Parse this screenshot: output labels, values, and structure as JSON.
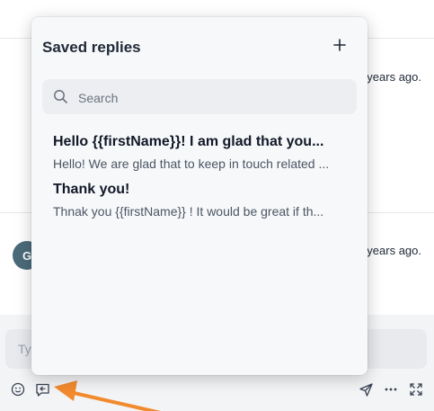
{
  "background": {
    "times": [
      "years ago.",
      "years ago."
    ],
    "avatar_initial": "G",
    "composer_placeholder": "Ty"
  },
  "popover": {
    "title": "Saved replies",
    "add_icon": "plus-icon",
    "search": {
      "placeholder": "Search",
      "icon": "search-icon"
    },
    "replies": [
      {
        "title": "Hello {{firstName}}! I am glad that you...",
        "body": "Hello! We are glad that to keep in touch related ..."
      },
      {
        "title": "Thank you!",
        "body": "Thnak you {{firstName}} ! It would be great if th..."
      }
    ]
  },
  "toolbar": {
    "icons": [
      "emoji-icon",
      "saved-replies-icon",
      "send-icon",
      "more-icon",
      "expand-icon"
    ]
  },
  "colors": {
    "arrow": "#f28a2e",
    "avatar": "#4b6b7a",
    "popover_bg": "#f7f8fa"
  }
}
